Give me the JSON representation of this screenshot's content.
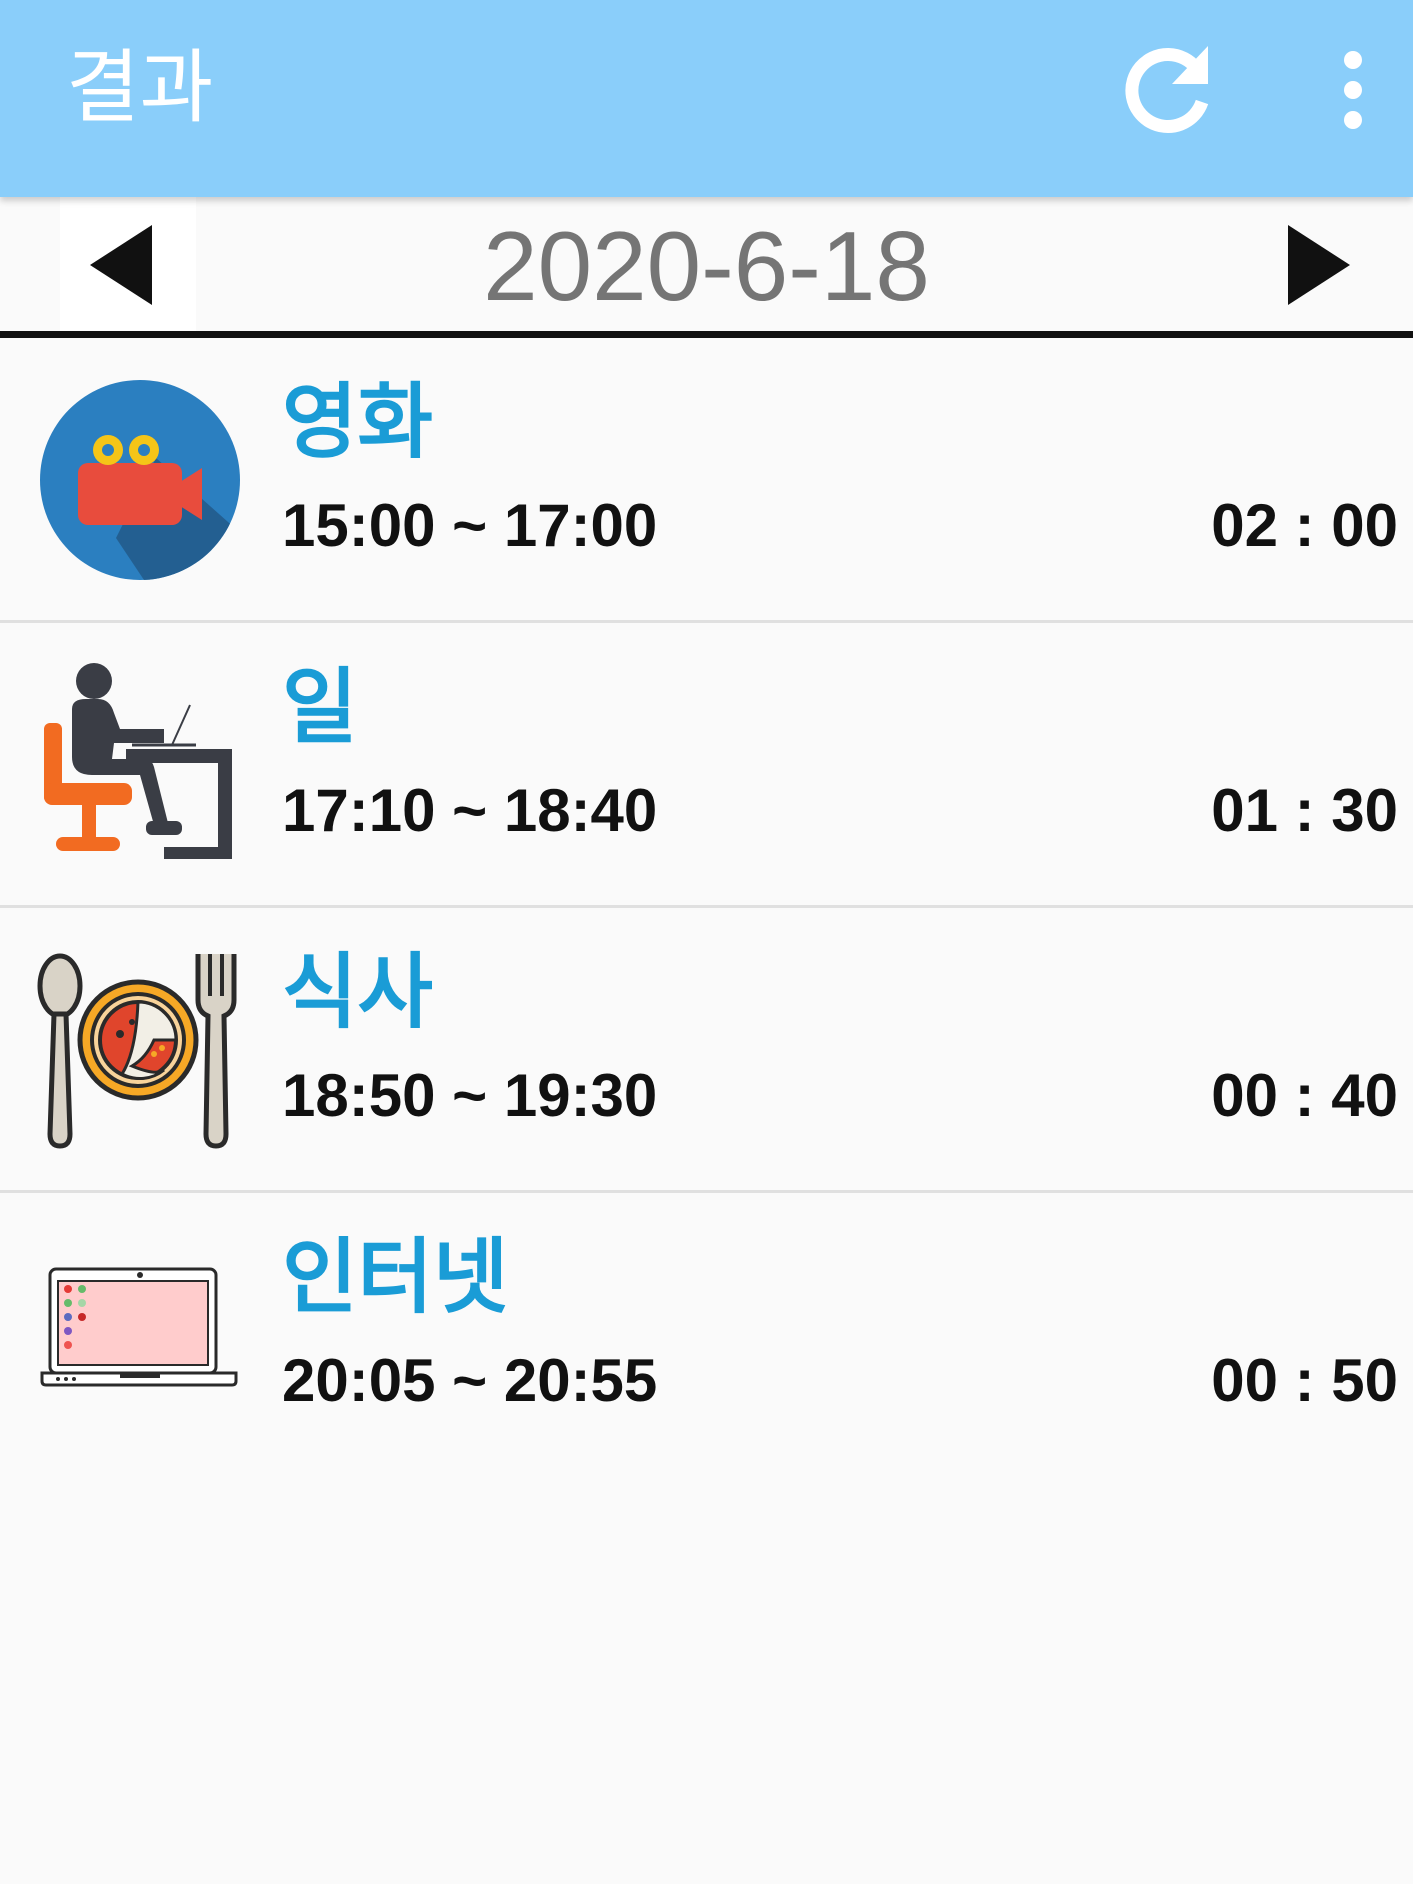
{
  "app_bar": {
    "title": "결과",
    "refresh_icon": "refresh-icon",
    "menu_icon": "more-vert-icon",
    "background_color": "#8acefa"
  },
  "date_nav": {
    "date": "2020-6-18",
    "prev_icon": "triangle-left-icon",
    "next_icon": "triangle-right-icon"
  },
  "activities": [
    {
      "name": "영화",
      "time_range": "15:00 ~ 17:00",
      "duration": "02 : 00",
      "icon": "movie-camera-icon"
    },
    {
      "name": "일",
      "time_range": "17:10 ~ 18:40",
      "duration": "01 : 30",
      "icon": "desk-worker-icon"
    },
    {
      "name": "식사",
      "time_range": "18:50 ~ 19:30",
      "duration": "00 : 40",
      "icon": "meal-icon"
    },
    {
      "name": "인터넷",
      "time_range": "20:05 ~ 20:55",
      "duration": "00 : 50",
      "icon": "laptop-icon"
    }
  ],
  "colors": {
    "name_text": "#1a9cd6",
    "time_text": "#111111",
    "date_text": "#757575"
  }
}
